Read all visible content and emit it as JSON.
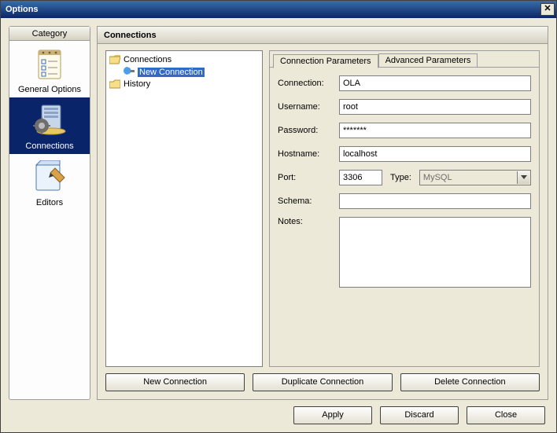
{
  "window": {
    "title": "Options"
  },
  "category": {
    "header": "Category",
    "items": [
      {
        "label": "General Options",
        "selected": false
      },
      {
        "label": "Connections",
        "selected": true
      },
      {
        "label": "Editors",
        "selected": false
      }
    ]
  },
  "content": {
    "title": "Connections",
    "tree": {
      "root": "Connections",
      "rootChild": "New Connection",
      "history": "History"
    },
    "tabs": [
      {
        "label": "Connection Parameters",
        "active": true
      },
      {
        "label": "Advanced Parameters",
        "active": false
      }
    ],
    "form": {
      "connection": {
        "label": "Connection:",
        "value": "OLA"
      },
      "username": {
        "label": "Username:",
        "value": "root"
      },
      "password": {
        "label": "Password:",
        "value": "*******"
      },
      "hostname": {
        "label": "Hostname:",
        "value": "localhost"
      },
      "port": {
        "label": "Port:",
        "value": "3306"
      },
      "type": {
        "label": "Type:",
        "value": "MySQL"
      },
      "schema": {
        "label": "Schema:",
        "value": ""
      },
      "notes": {
        "label": "Notes:",
        "value": ""
      }
    },
    "connButtons": {
      "new": "New Connection",
      "dup": "Duplicate Connection",
      "del": "Delete Connection"
    }
  },
  "footer": {
    "apply": "Apply",
    "discard": "Discard",
    "close": "Close"
  }
}
